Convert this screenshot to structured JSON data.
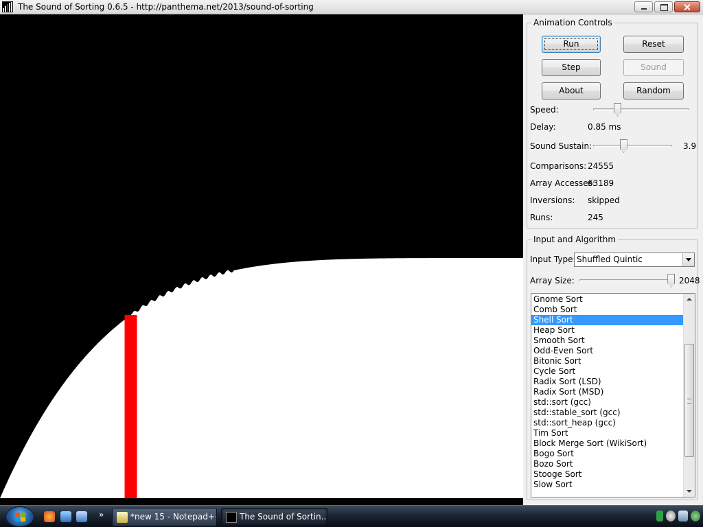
{
  "window": {
    "title": "The Sound of Sorting 0.6.5 - http://panthema.net/2013/sound-of-sorting"
  },
  "animation_controls": {
    "group_title": "Animation Controls",
    "buttons": {
      "run": "Run",
      "reset": "Reset",
      "step": "Step",
      "sound": "Sound",
      "about": "About",
      "random": "Random"
    },
    "speed_label": "Speed:",
    "speed_fraction": 0.25,
    "delay_label": "Delay:",
    "delay_value": "0.85 ms",
    "sound_sustain_label": "Sound Sustain:",
    "sound_sustain_value": "3.9",
    "sound_sustain_fraction": 0.38,
    "stats": {
      "comparisons_label": "Comparisons:",
      "comparisons_value": "24555",
      "array_accesses_label": "Array Accesses:",
      "array_accesses_value": "63189",
      "inversions_label": "Inversions:",
      "inversions_value": "skipped",
      "runs_label": "Runs:",
      "runs_value": "245"
    }
  },
  "input_algorithm": {
    "group_title": "Input and Algorithm",
    "input_type_label": "Input Type:",
    "input_type_value": "Shuffled Quintic",
    "array_size_label": "Array Size:",
    "array_size_value": "2048",
    "array_size_fraction": 0.98,
    "algorithms": [
      "Gnome Sort",
      "Comb Sort",
      "Shell Sort",
      "Heap Sort",
      "Smooth Sort",
      "Odd-Even Sort",
      "Bitonic Sort",
      "Cycle Sort",
      "Radix Sort (LSD)",
      "Radix Sort (MSD)",
      "std::sort (gcc)",
      "std::stable_sort (gcc)",
      "std::sort_heap (gcc)",
      "Tim Sort",
      "Block Merge Sort (WikiSort)",
      "Bogo Sort",
      "Bozo Sort",
      "Stooge Sort",
      "Slow Sort"
    ],
    "selected_algorithm": "Shell Sort",
    "list_scroll_fraction": 0.58
  },
  "visualization": {
    "bar_color": "#ffffff",
    "highlight_color": "#ff0000",
    "background_color": "#000000",
    "highlight_position_fraction": 0.25
  },
  "taskbar": {
    "items": [
      {
        "label": "*new 15 - Notepad++",
        "active": false
      },
      {
        "label": "The Sound of Sortin...",
        "active": true
      }
    ]
  }
}
